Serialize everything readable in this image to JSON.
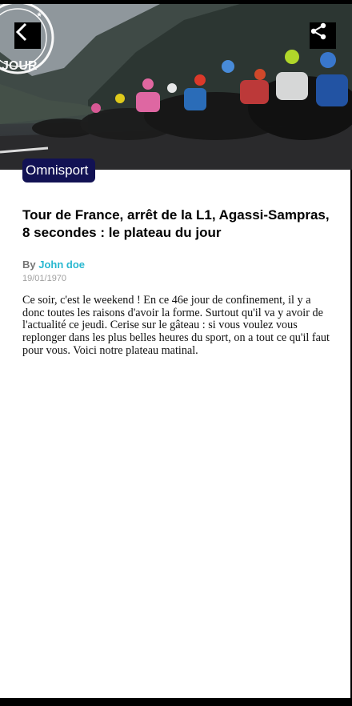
{
  "article": {
    "category": "Omnisport",
    "title": "Tour de France, arrêt de la L1, Agassi-Sampras, 8 secondes : le plateau du jour",
    "byline_prefix": "By",
    "author": "John doe",
    "date": "19/01/1970",
    "body": "Ce soir, c'est le weekend ! En ce 46e jour de confinement, il y a donc toutes les raisons d'avoir la forme. Surtout qu'il va y avoir de l'actualité ce jeudi. Cerise sur le gâteau : si vous voulez vous replonger dans les plus belles heures du sport, on a tout ce qu'il faut pour vous. Voici notre plateau matinal."
  },
  "hero": {
    "logo_text": "JOUR",
    "icons": {
      "back": "chevron-left-icon",
      "share": "share-icon"
    }
  },
  "colors": {
    "badge_bg": "#121254",
    "author": "#29b8d0"
  }
}
